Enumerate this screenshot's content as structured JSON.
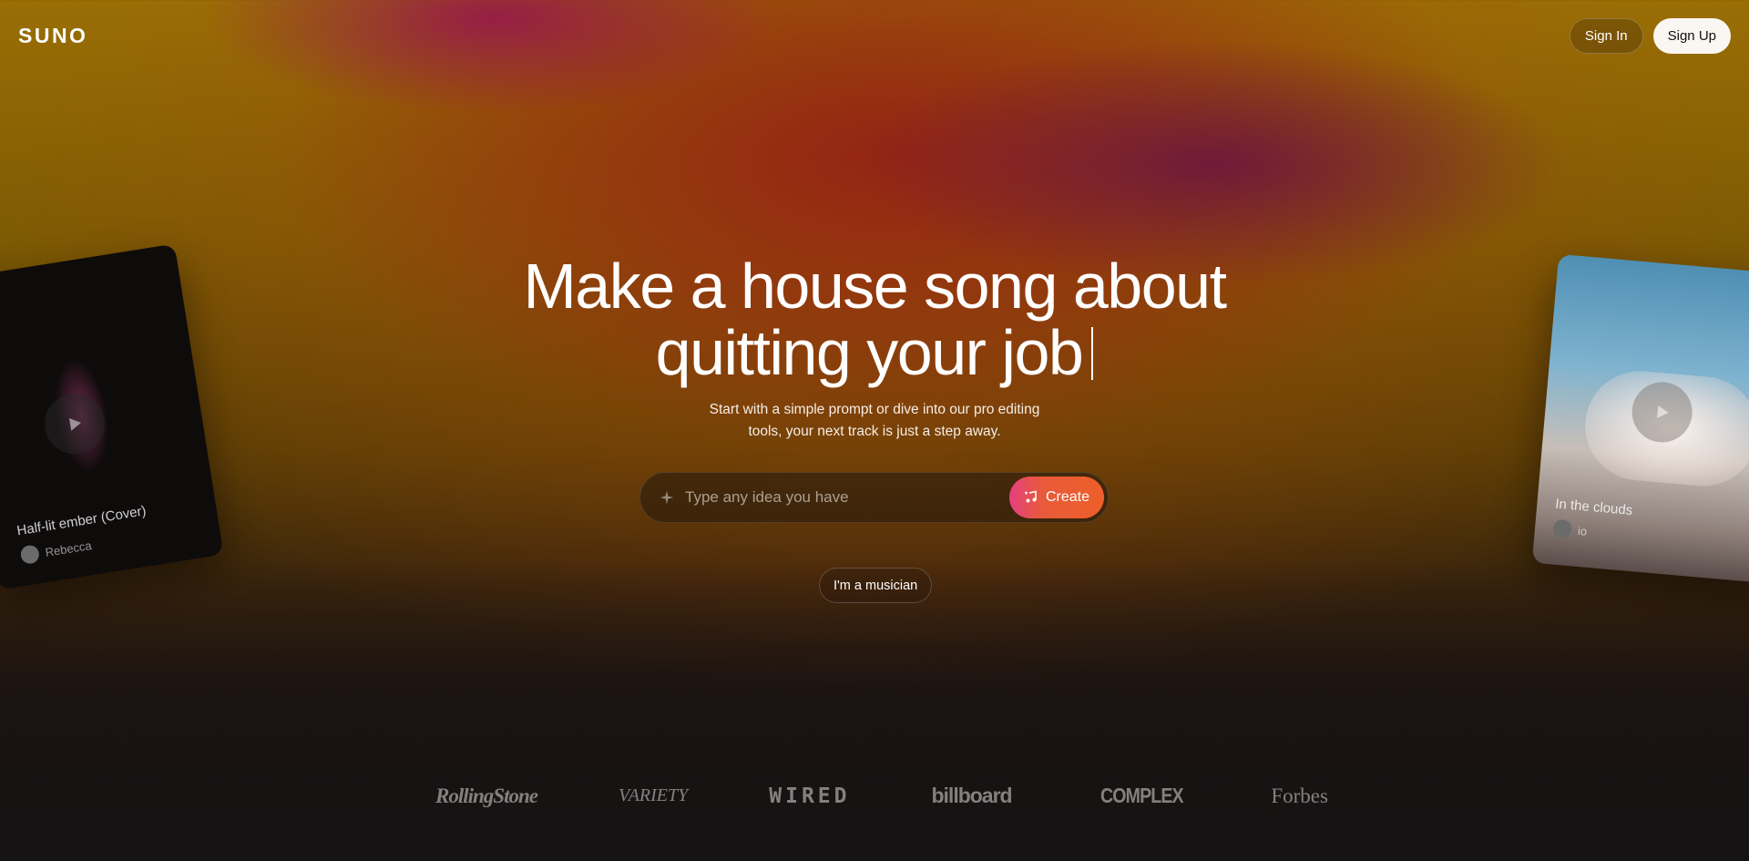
{
  "brand": {
    "logo": "SUNO"
  },
  "header": {
    "sign_in": "Sign In",
    "sign_up": "Sign Up"
  },
  "hero": {
    "headline_line1": "Make a house song about",
    "headline_line2": "quitting your job",
    "subtitle": "Start with a simple prompt or dive into our pro editing tools, your next track is just a step away."
  },
  "prompt": {
    "placeholder": "Type any idea you have",
    "value": "",
    "create_label": "Create"
  },
  "musician_button": "I'm a musician",
  "cards": [
    {
      "title": "Half-lit ember (Cover)",
      "artist": "Rebecca"
    },
    {
      "title": "In the clouds",
      "artist": "io"
    }
  ],
  "press": [
    "RollingStone",
    "VARIETY",
    "WIRED",
    "billboard",
    "COMPLEX",
    "Forbes"
  ],
  "icons": {
    "prompt": "sparkle-icon",
    "create": "music-note-plus-icon",
    "card_play": "play-icon"
  },
  "colors": {
    "create_gradient_start": "#e4407f",
    "create_gradient_end": "#ee5f2a",
    "sign_up_bg": "#faf6f2"
  }
}
